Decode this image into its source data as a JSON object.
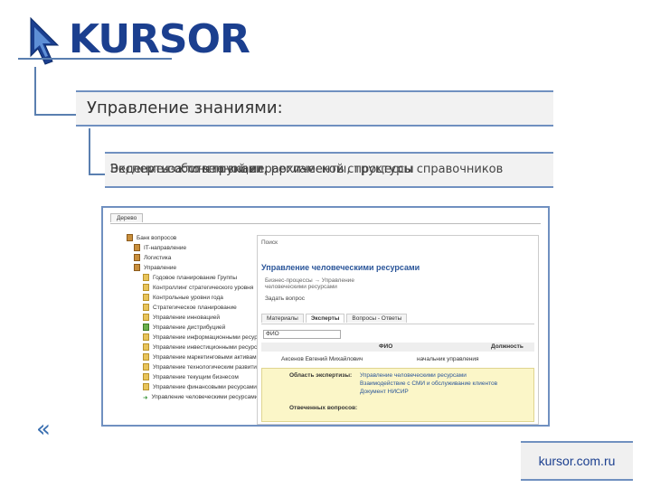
{
  "logo": {
    "text": "KURSOR"
  },
  "heading": "Управление знаниями:",
  "subtitle_overlap": [
    "Ведение собственной иерархической структуры справочников",
    "Экспертиза: инструкции, регламенты, процессы",
    "Эксперты: кто что знает"
  ],
  "screenshot": {
    "tab": "Дерево",
    "tree": [
      {
        "label": "Банк вопросов",
        "icon": "folder-icon"
      },
      {
        "label": "IT-направление",
        "icon": "folder-icon"
      },
      {
        "label": "Логистика",
        "icon": "folder-icon"
      },
      {
        "label": "Управление",
        "icon": "folder-icon"
      },
      {
        "label": "Годовое планирование Группы",
        "icon": "doc-icon"
      },
      {
        "label": "Контроллинг стратегического уровня",
        "icon": "doc-icon"
      },
      {
        "label": "Контрольные уровни года",
        "icon": "doc-icon"
      },
      {
        "label": "Стратегическое планирование",
        "icon": "doc-icon"
      },
      {
        "label": "Управление инновацией",
        "icon": "doc-icon"
      },
      {
        "label": "Управление дистрибуцией",
        "icon": "check-icon"
      },
      {
        "label": "Управление информационными ресурсами",
        "icon": "doc-icon"
      },
      {
        "label": "Управление инвестиционными ресурсами",
        "icon": "doc-icon"
      },
      {
        "label": "Управление маркетинговыми активами",
        "icon": "doc-icon"
      },
      {
        "label": "Управление технологическим развитием",
        "icon": "doc-icon"
      },
      {
        "label": "Управление текущим бизнесом",
        "icon": "doc-icon"
      },
      {
        "label": "Управление финансовыми ресурсами",
        "icon": "doc-icon"
      },
      {
        "label": "Управление человеческими ресурсами",
        "icon": "arrow-icon"
      }
    ],
    "panel": {
      "search": "Поиск",
      "title": "Управление человеческими ресурсами",
      "breadcrumb": "Бизнес-процессы → Управление человеческими ресурсами",
      "ask": "Задать вопрос",
      "tabs": [
        "Материалы",
        "Эксперты",
        "Вопросы - Ответы"
      ],
      "active_tab": "Эксперты",
      "select": "ФИО",
      "columns": [
        "ФИО",
        "Должность"
      ],
      "row": {
        "name": "Аксенов Евгений Михайлович",
        "position": "начальник управления"
      },
      "detail_label_1": "Область экспертизы:",
      "detail_values": [
        "Управление человеческими ресурсами",
        "Взаимодействие с СМИ и обслуживание клиентов",
        "Документ НИСИР"
      ],
      "detail_label_2": "Отвеченных вопросов:"
    }
  },
  "footer": {
    "site": "kursor.com.ru"
  },
  "colors": {
    "brand": "#1b3f8f",
    "accent": "#5a7fb0"
  }
}
